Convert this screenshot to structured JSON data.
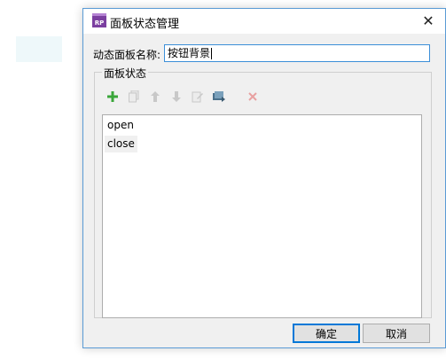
{
  "dialog": {
    "icon_text": "RP",
    "title": "面板状态管理",
    "close_glyph": "✕"
  },
  "form": {
    "name_label": "动态面板名称:",
    "name_value": "按钮背景"
  },
  "states_group": {
    "title": "面板状态",
    "toolbar": [
      {
        "name": "add-state",
        "icon": "plus-icon",
        "enabled": true,
        "color": "#3aa63a"
      },
      {
        "name": "duplicate-state",
        "icon": "copy-icon",
        "enabled": false
      },
      {
        "name": "move-up",
        "icon": "arrow-up-icon",
        "enabled": false
      },
      {
        "name": "move-down",
        "icon": "arrow-down-icon",
        "enabled": false
      },
      {
        "name": "edit-state",
        "icon": "edit-icon",
        "enabled": false
      },
      {
        "name": "edit-all-states",
        "icon": "edit-all-icon",
        "enabled": true
      },
      {
        "name": "delete-state",
        "icon": "delete-icon",
        "enabled": false,
        "color": "#e07a7a"
      }
    ],
    "items": [
      {
        "label": "open",
        "selected": false
      },
      {
        "label": "close",
        "selected": true
      }
    ]
  },
  "buttons": {
    "ok_label": "确定",
    "cancel_label": "取消"
  }
}
